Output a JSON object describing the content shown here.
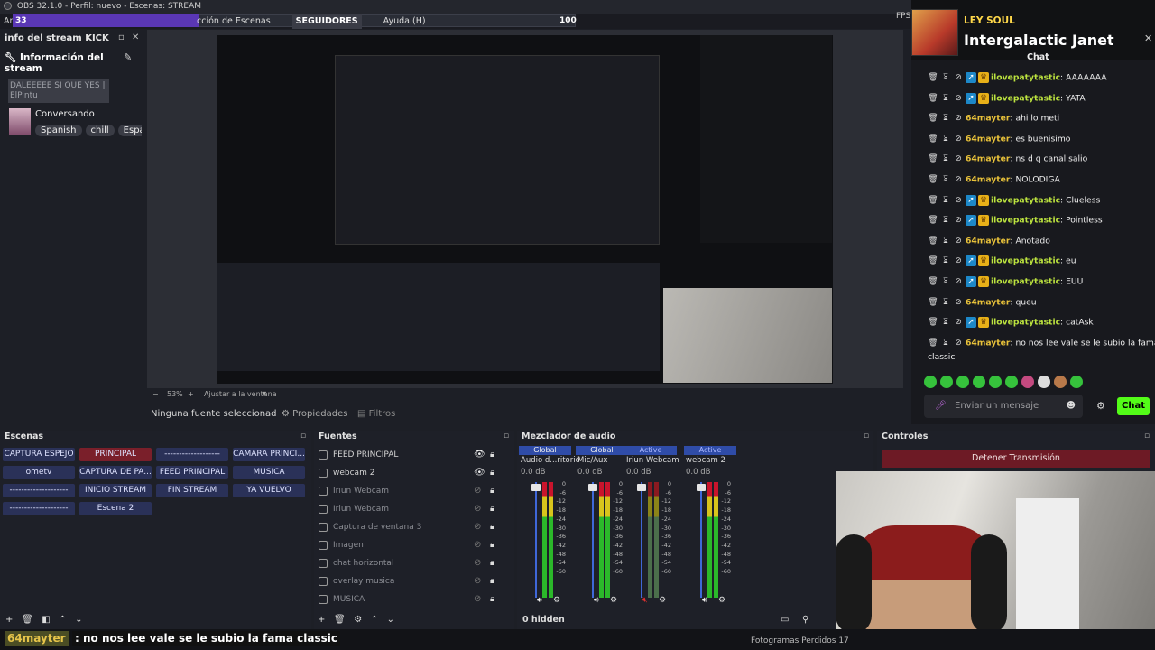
{
  "titlebar": {
    "title": "OBS 32.1.0 - Perfil: nuevo - Escenas: STREAM"
  },
  "menubar": {
    "left_fragment": "Ar",
    "progress_left": "33",
    "progress_right": "100",
    "progress_fraction": 0.33,
    "items": [
      "cción de Escenas",
      "SEGUIDORES",
      "Ayuda (H)"
    ],
    "fps_fragment": "FPS"
  },
  "info_dock": {
    "title": "info del stream KICK",
    "heading": "Información del stream",
    "blurred_text": "DALEEEEE SI QUE YES | ElPintu",
    "category": "Conversando",
    "tags": [
      "Spanish",
      "chill",
      "Espa"
    ]
  },
  "preview": {
    "zoom": "53%",
    "fit_label": "Ajustar a la ventana"
  },
  "source_bar": {
    "none_selected": "Ninguna fuente seleccionad",
    "properties": "Propiedades",
    "filters": "Filtros"
  },
  "chat": {
    "streamer_badge": "LEY SOUL",
    "streamer_name": "Intergalactic Janet",
    "title": "Chat",
    "lines": [
      {
        "user": "ilovepatytastic",
        "msg": ": AAAAAAA",
        "color": "#bde43f",
        "badges": true
      },
      {
        "user": "ilovepatytastic",
        "msg": ": YATA",
        "color": "#bde43f",
        "badges": true
      },
      {
        "user": "64mayter",
        "msg": ": ahi lo meti",
        "color": "#e9c23a",
        "badges": false
      },
      {
        "user": "64mayter",
        "msg": ": es buenisimo",
        "color": "#e9c23a",
        "badges": false
      },
      {
        "user": "64mayter",
        "msg": ": ns d q canal salio",
        "color": "#e9c23a",
        "badges": false
      },
      {
        "user": "64mayter",
        "msg": ": NOLODIGA",
        "color": "#e9c23a",
        "badges": false
      },
      {
        "user": "ilovepatytastic",
        "msg": ": Clueless",
        "color": "#bde43f",
        "badges": true
      },
      {
        "user": "ilovepatytastic",
        "msg": ": Pointless",
        "color": "#bde43f",
        "badges": true
      },
      {
        "user": "64mayter",
        "msg": ": Anotado",
        "color": "#e9c23a",
        "badges": false
      },
      {
        "user": "ilovepatytastic",
        "msg": ": eu",
        "color": "#bde43f",
        "badges": true
      },
      {
        "user": "ilovepatytastic",
        "msg": ": EUU",
        "color": "#bde43f",
        "badges": true
      },
      {
        "user": "64mayter",
        "msg": ": queu",
        "color": "#e9c23a",
        "badges": false
      },
      {
        "user": "ilovepatytastic",
        "msg": ": catAsk",
        "color": "#bde43f",
        "badges": true
      },
      {
        "user": "64mayter",
        "msg": ": no nos lee vale se le subio la fama",
        "color": "#e9c23a",
        "badges": false
      }
    ],
    "last_line_cont": "classic",
    "input_placeholder": "Enviar un mensaje",
    "send_label": "Chat"
  },
  "scenes": {
    "title": "Escenas",
    "items": [
      {
        "label": "CAPTURA ESPEJO",
        "active": false
      },
      {
        "label": "PRINCIPAL",
        "active": true
      },
      {
        "label": "-------------------",
        "active": false
      },
      {
        "label": "CAMARA PRINCI...",
        "active": false
      },
      {
        "label": "ometv",
        "active": false
      },
      {
        "label": "CAPTURA DE PA...",
        "active": false
      },
      {
        "label": "FEED PRINCIPAL",
        "active": false
      },
      {
        "label": "MUSICA",
        "active": false
      },
      {
        "label": "--------------------",
        "active": false
      },
      {
        "label": "INICIO STREAM",
        "active": false
      },
      {
        "label": "FIN STREAM",
        "active": false
      },
      {
        "label": "YA VUELVO",
        "active": false
      },
      {
        "label": "--------------------",
        "active": false
      },
      {
        "label": "Escena 2",
        "active": false
      }
    ]
  },
  "sources": {
    "title": "Fuentes",
    "items": [
      {
        "label": "FEED PRINCIPAL",
        "visible": true
      },
      {
        "label": "webcam 2",
        "visible": true
      },
      {
        "label": "Iriun Webcam",
        "visible": false
      },
      {
        "label": "Iriun Webcam",
        "visible": false
      },
      {
        "label": "Captura de ventana 3",
        "visible": false
      },
      {
        "label": "Imagen",
        "visible": false
      },
      {
        "label": "chat horizontal",
        "visible": false
      },
      {
        "label": "overlay musica",
        "visible": false
      },
      {
        "label": "MUSICA",
        "visible": false
      }
    ]
  },
  "mixer": {
    "title": "Mezclador de audio",
    "channels": [
      {
        "tag": "Global",
        "name": "Audio d...ritorio",
        "db": "0.0 dB",
        "muted": false
      },
      {
        "tag": "Global",
        "name": "Mic/Aux",
        "db": "0.0 dB",
        "muted": false
      },
      {
        "tag": "Active",
        "name": "Iriun Webcam",
        "db": "0.0 dB",
        "muted": true
      },
      {
        "tag": "Active",
        "name": "webcam 2",
        "db": "0.0 dB",
        "muted": false
      }
    ],
    "scale": [
      "0",
      "-6",
      "-12",
      "-18",
      "-24",
      "-30",
      "-36",
      "-42",
      "-48",
      "-54",
      "-60"
    ],
    "hidden": "0 hidden"
  },
  "controls": {
    "title": "Controles",
    "stop": "Detener Transmisión"
  },
  "ticker": {
    "user": "64mayter",
    "msg": ": no nos lee vale se le subio la fama classic"
  },
  "status": {
    "frames_lost": "Fotogramas Perdidos 17"
  }
}
